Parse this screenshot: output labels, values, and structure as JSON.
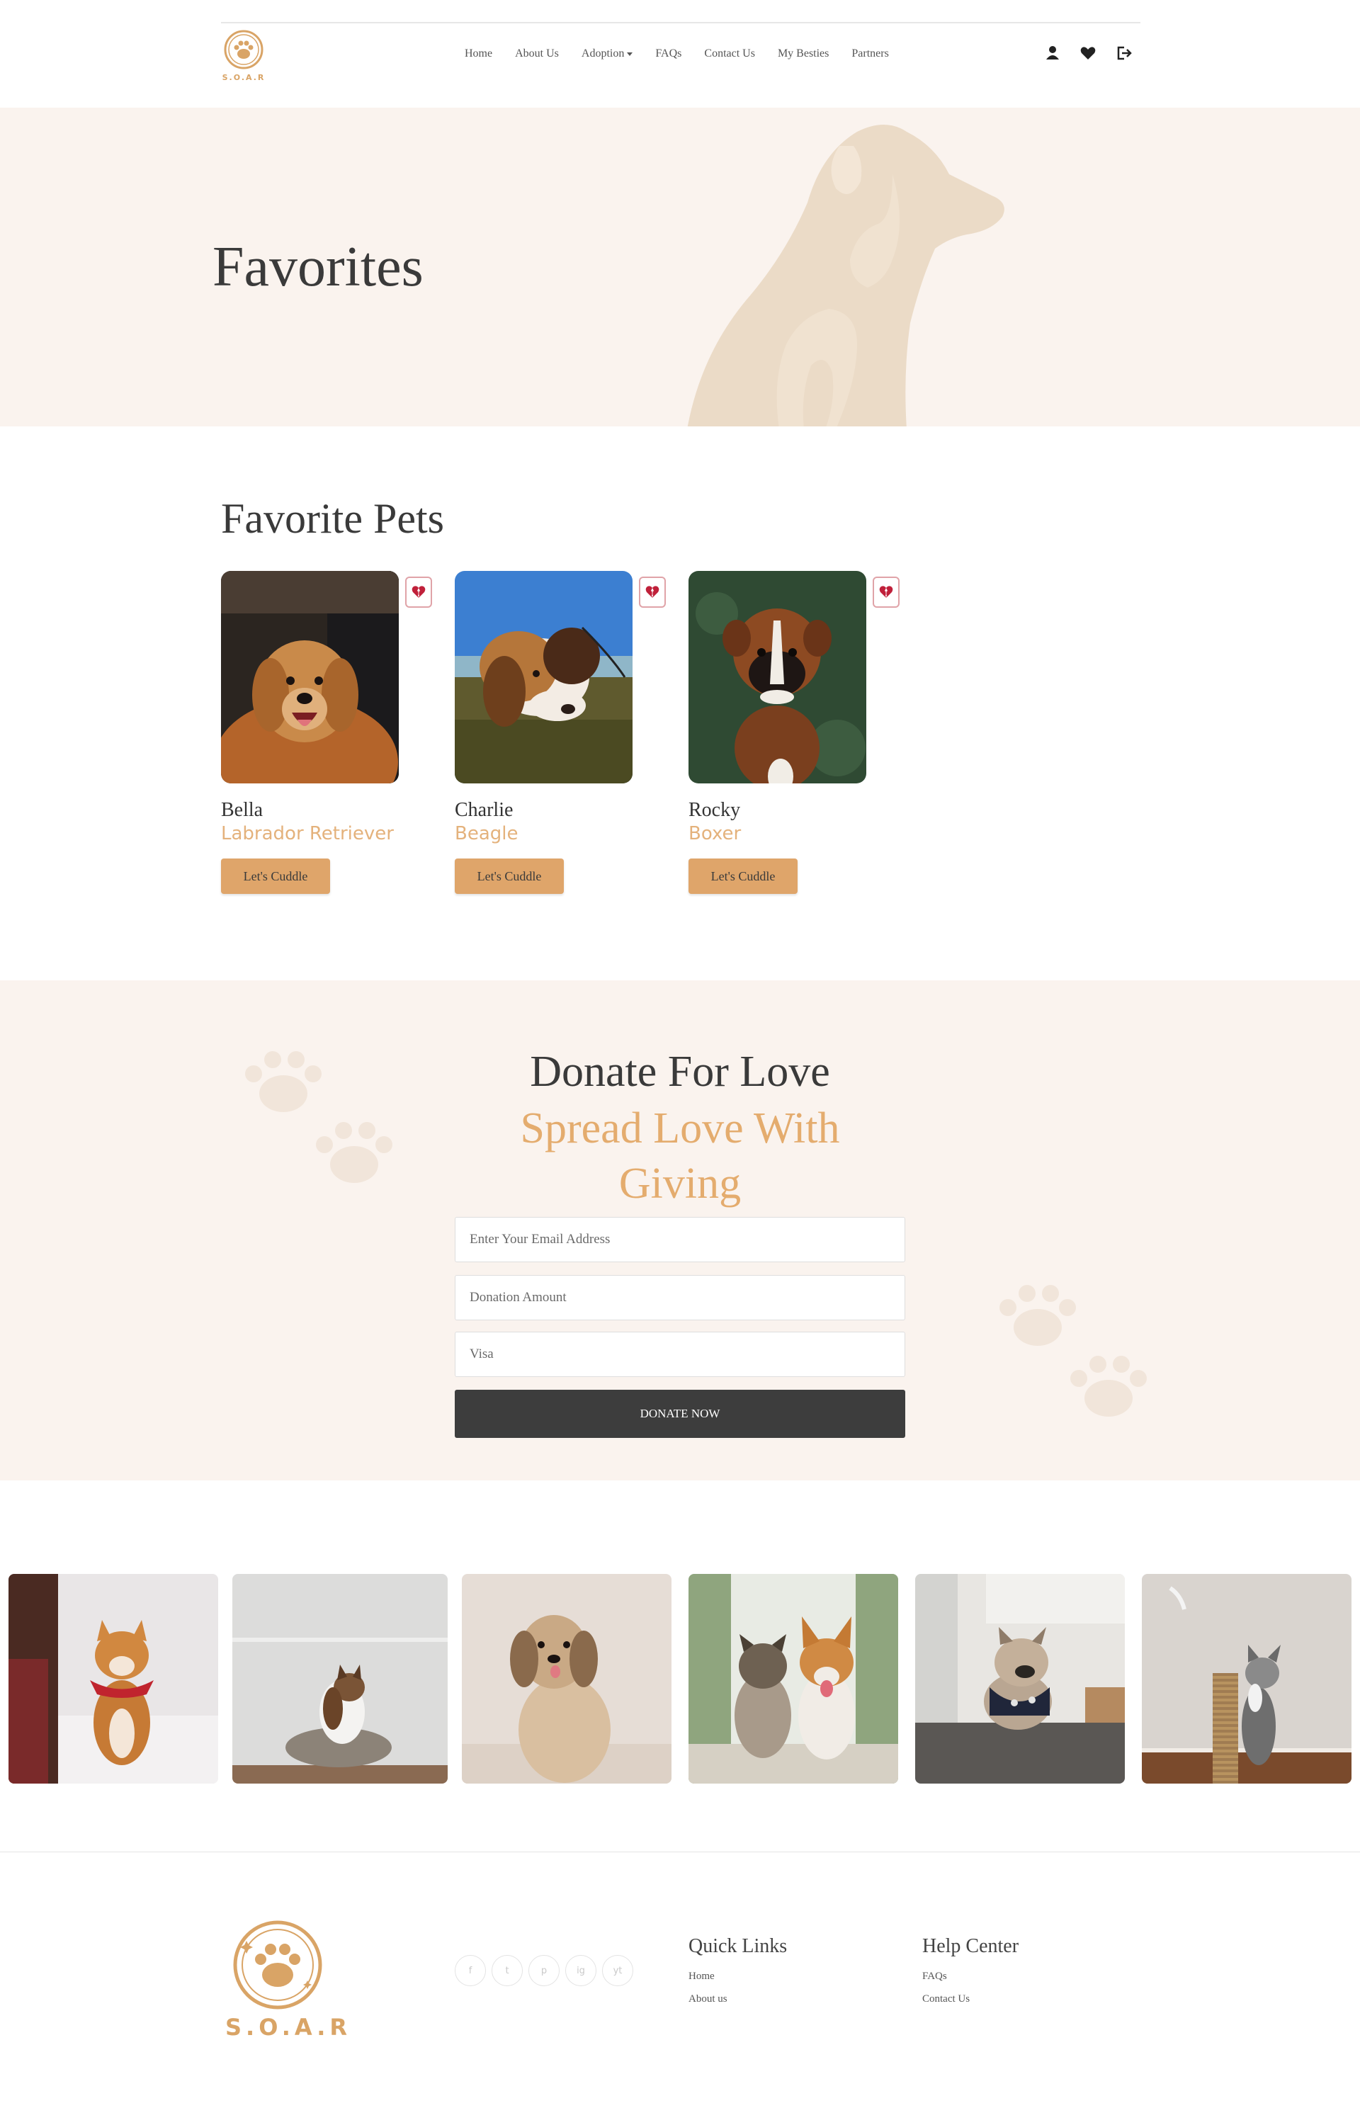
{
  "brand": {
    "name": "S.O.A.R",
    "accent": "#dfa56a",
    "cream": "#faf3ee",
    "dark": "#3d3d3d"
  },
  "nav": {
    "items": [
      {
        "label": "Home"
      },
      {
        "label": "About Us"
      },
      {
        "label": "Adoption"
      },
      {
        "label": "FAQs"
      },
      {
        "label": "Contact Us"
      },
      {
        "label": "My Besties"
      },
      {
        "label": "Partners"
      }
    ],
    "icons": [
      "user-icon",
      "heart-icon",
      "logout-icon"
    ]
  },
  "hero": {
    "title": "Favorites"
  },
  "favorites": {
    "title": "Favorite Pets",
    "pets": [
      {
        "name": "Bella",
        "breed": "Labrador Retriever",
        "button": "Let's Cuddle"
      },
      {
        "name": "Charlie",
        "breed": "Beagle",
        "button": "Let's Cuddle"
      },
      {
        "name": "Rocky",
        "breed": "Boxer",
        "button": "Let's Cuddle"
      }
    ]
  },
  "donate": {
    "title": "Donate For Love",
    "subtitle_line1": "Spread Love With",
    "subtitle_line2": "Giving",
    "email_placeholder": "Enter Your Email Address",
    "amount_placeholder": "Donation Amount",
    "card_placeholder": "Visa",
    "button": "DONATE NOW"
  },
  "footer": {
    "brand": "S.O.A.R",
    "social": [
      "f",
      "t",
      "p",
      "ig",
      "yt"
    ],
    "quick_links": {
      "title": "Quick Links",
      "links": [
        "Home",
        "About us"
      ]
    },
    "help_center": {
      "title": "Help Center",
      "links": [
        "FAQs",
        "Contact Us"
      ]
    }
  }
}
